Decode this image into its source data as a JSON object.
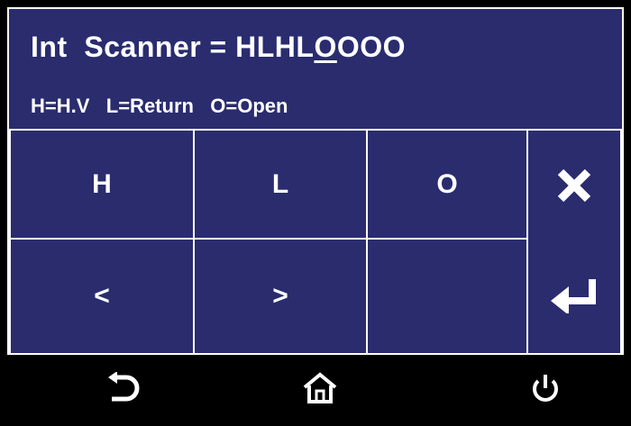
{
  "header": {
    "label": "Int",
    "name": "Scanner",
    "equals": "=",
    "value_before_cursor": "HLHL",
    "value_cursor": "O",
    "value_after_cursor": "OOO"
  },
  "legend": {
    "h": "H=H.V",
    "l": "L=Return",
    "o": "O=Open"
  },
  "keypad": {
    "h_label": "H",
    "l_label": "L",
    "o_label": "O",
    "left_label": "<",
    "right_label": ">",
    "clear_icon": "close-icon",
    "enter_icon": "enter-icon"
  },
  "nav": {
    "back_icon": "back-icon",
    "home_icon": "home-icon",
    "power_icon": "power-icon"
  },
  "colors": {
    "panel": "#2a2c6e",
    "border": "#ffffff",
    "text": "#ffffff",
    "nav_bar": "#000000"
  }
}
